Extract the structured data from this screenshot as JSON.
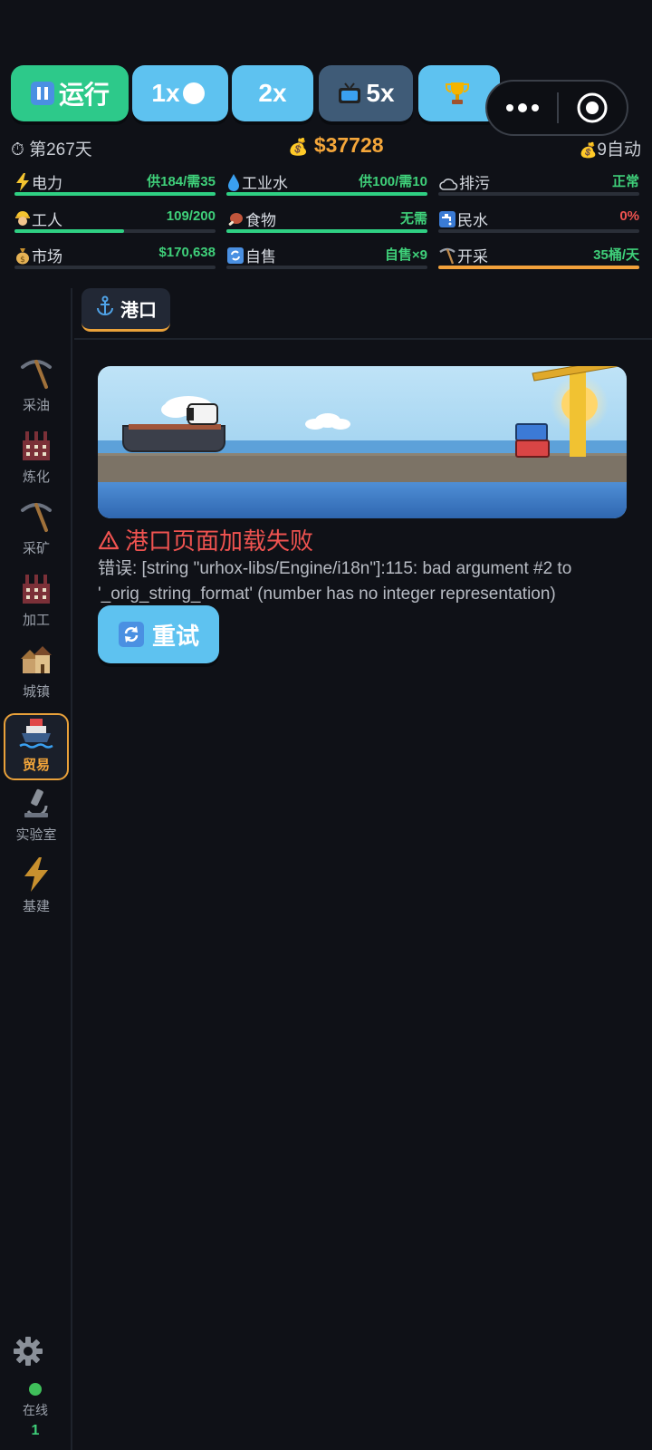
{
  "controls": {
    "run_label": "运行",
    "speed_1x": "1x",
    "speed_2x": "2x",
    "speed_5x": "5x",
    "icons": [
      "pause-icon",
      "moon-icon",
      "tv-icon",
      "trophy-icon",
      "more-icon",
      "target-icon"
    ]
  },
  "info": {
    "day": "第267天",
    "money": "$37728",
    "auto": "9自动"
  },
  "stats": [
    {
      "icon": "lightning-icon",
      "label": "电力",
      "value": "供184/需35",
      "fill": 1.0,
      "color": "#2fd083",
      "value_color": "#3fd07a"
    },
    {
      "icon": "droplet-icon",
      "label": "工业水",
      "value": "供100/需10",
      "fill": 1.0,
      "color": "#2fd083",
      "value_color": "#3fd07a"
    },
    {
      "icon": "cloud-icon",
      "label": "排污",
      "value": "正常",
      "fill": 0.0,
      "color": "#2fd083",
      "value_color": "#3fd07a"
    },
    {
      "icon": "worker-icon",
      "label": "工人",
      "value": "109/200",
      "fill": 0.545,
      "color": "#2fd083",
      "value_color": "#3fd07a"
    },
    {
      "icon": "meat-icon",
      "label": "食物",
      "value": "无需",
      "fill": 1.0,
      "color": "#2fd083",
      "value_color": "#3fd07a"
    },
    {
      "icon": "faucet-icon",
      "label": "民水",
      "value": "0%",
      "fill": 0.0,
      "color": "#2fd083",
      "value_color": "#ef5350"
    },
    {
      "icon": "moneybag-icon",
      "label": "市场",
      "value": "$170,638",
      "fill": 0.0,
      "color": "#2fd083",
      "value_color": "#3fd07a"
    },
    {
      "icon": "cycle-icon",
      "label": "自售",
      "value": "自售×9",
      "fill": 0.0,
      "color": "#2fd083",
      "value_color": "#3fd07a"
    },
    {
      "icon": "pickaxe-icon",
      "label": "开采",
      "value": "35桶/天",
      "fill": 1.0,
      "color": "#f2a13b",
      "value_color": "#3fd07a"
    }
  ],
  "sidebar": {
    "items": [
      {
        "label": "采油",
        "icon": "pickaxe-icon"
      },
      {
        "label": "炼化",
        "icon": "factory-icon"
      },
      {
        "label": "采矿",
        "icon": "pickaxe-icon"
      },
      {
        "label": "加工",
        "icon": "factory-icon"
      },
      {
        "label": "城镇",
        "icon": "houses-icon"
      },
      {
        "label": "贸易",
        "icon": "ship-icon",
        "active": true
      },
      {
        "label": "实验室",
        "icon": "microscope-icon"
      },
      {
        "label": "基建",
        "icon": "lightning-icon"
      }
    ],
    "online_label": "在线",
    "online_count": "1"
  },
  "tab": {
    "label": "港口",
    "icon": "anchor-icon"
  },
  "error": {
    "title": "港口页面加载失败",
    "message": "错误: [string \"urhox-libs/Engine/i18n\"]:115: bad argument #2 to '_orig_string_format' (number has no integer representation)",
    "retry_label": "重试"
  },
  "colors": {
    "accent_green": "#2dc98a",
    "accent_blue": "#5ec2f0",
    "accent_orange": "#f4a63a",
    "error_red": "#ef5350"
  }
}
